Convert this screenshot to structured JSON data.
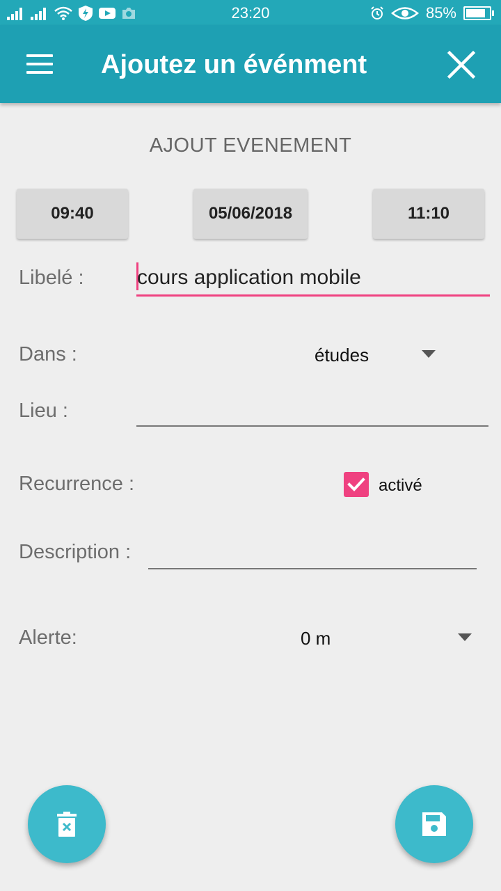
{
  "status_bar": {
    "time": "23:20",
    "battery": "85%",
    "battery_level": 0.85
  },
  "app_bar": {
    "title": "Ajoutez un événment"
  },
  "form": {
    "section_title": "AJOUT EVENEMENT",
    "start_time": "09:40",
    "date": "05/06/2018",
    "end_time": "11:10",
    "libele": {
      "label": "Libelé :",
      "value": "cours application mobile"
    },
    "dans": {
      "label": "Dans :",
      "value": "études"
    },
    "lieu": {
      "label": "Lieu :",
      "value": ""
    },
    "recurrence": {
      "label": "Recurrence :",
      "checkbox_label": "activé",
      "checked": true
    },
    "description": {
      "label": "Description :",
      "value": ""
    },
    "alerte": {
      "label": "Alerte:",
      "value": "0 m"
    }
  },
  "colors": {
    "app_bar": "#1ea0b3",
    "status_bar": "#23a8b8",
    "accent": "#ef4180",
    "fab": "#3dbacb"
  },
  "icons": [
    "signal-icon",
    "wifi-icon",
    "shield-icon",
    "youtube-icon",
    "camera-icon",
    "alarm-icon",
    "eye-icon",
    "battery-icon",
    "menu-icon",
    "close-icon",
    "delete-icon",
    "save-icon"
  ]
}
